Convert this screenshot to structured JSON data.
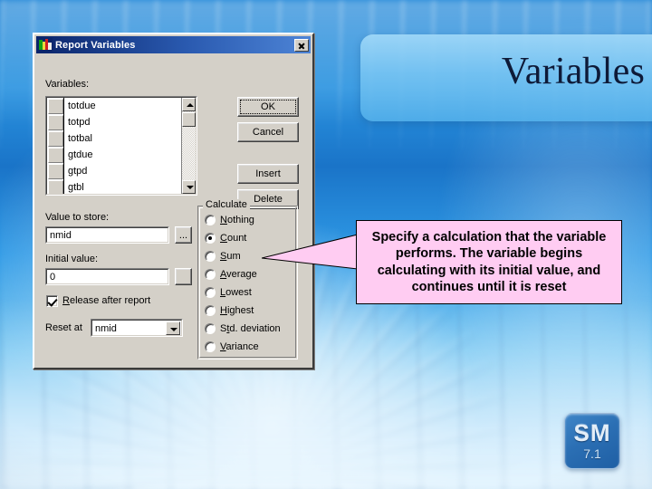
{
  "slide": {
    "title": "Variables",
    "logo": {
      "text": "SM",
      "version": "7.1"
    }
  },
  "dialog": {
    "titlebar": {
      "title": "Report Variables",
      "icon": "report-variables-icon",
      "close_label": "Close"
    },
    "variables_label": "Variables:",
    "variables_list": [
      "totdue",
      "totpd",
      "totbal",
      "gtdue",
      "gtpd",
      "gtbl"
    ],
    "buttons": {
      "ok": "OK",
      "cancel": "Cancel",
      "insert": "Insert",
      "delete": "Delete",
      "browse": "...",
      "browse2": ""
    },
    "value_to_store": {
      "label": "Value to store:",
      "value": "nmid"
    },
    "initial_value": {
      "label": "Initial value:",
      "value": "0"
    },
    "release_after_report": {
      "label": "Release after report",
      "checked": true
    },
    "reset_at": {
      "label": "Reset at",
      "value": "nmid"
    },
    "calculate": {
      "legend": "Calculate",
      "options": [
        {
          "label": "Nothing",
          "accel": "N",
          "selected": false
        },
        {
          "label": "Count",
          "accel": "C",
          "selected": true
        },
        {
          "label": "Sum",
          "accel": "S",
          "selected": false
        },
        {
          "label": "Average",
          "accel": "A",
          "selected": false
        },
        {
          "label": "Lowest",
          "accel": "L",
          "selected": false
        },
        {
          "label": "Highest",
          "accel": "H",
          "selected": false
        },
        {
          "label": "Std. deviation",
          "accel": "t",
          "selected": false
        },
        {
          "label": "Variance",
          "accel": "V",
          "selected": false
        }
      ]
    }
  },
  "callout": {
    "text": "Specify a calculation that the variable performs. The variable begins calculating with its initial value, and continues until it is reset",
    "fill_color": "#ffccf2",
    "border_color": "#000000",
    "points_at": "radio-average"
  }
}
